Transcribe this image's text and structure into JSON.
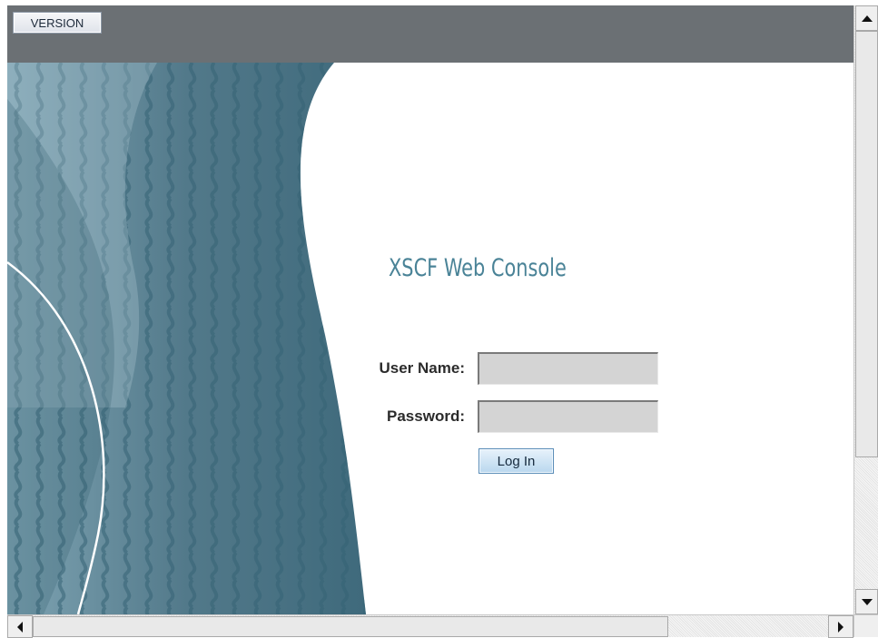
{
  "header": {
    "version_label": "VERSION"
  },
  "login": {
    "title": "XSCF Web Console",
    "username_label": "User Name:",
    "username_value": "",
    "password_label": "Password:",
    "password_value": "",
    "login_label": "Log In"
  },
  "colors": {
    "topbar": "#6b7074",
    "decor_teal": "#3f6f82",
    "title": "#4a8397",
    "field_bg": "#d4d4d4"
  },
  "icons": {
    "scroll_up": "triangle-up",
    "scroll_down": "triangle-down",
    "scroll_left": "triangle-left",
    "scroll_right": "triangle-right"
  }
}
